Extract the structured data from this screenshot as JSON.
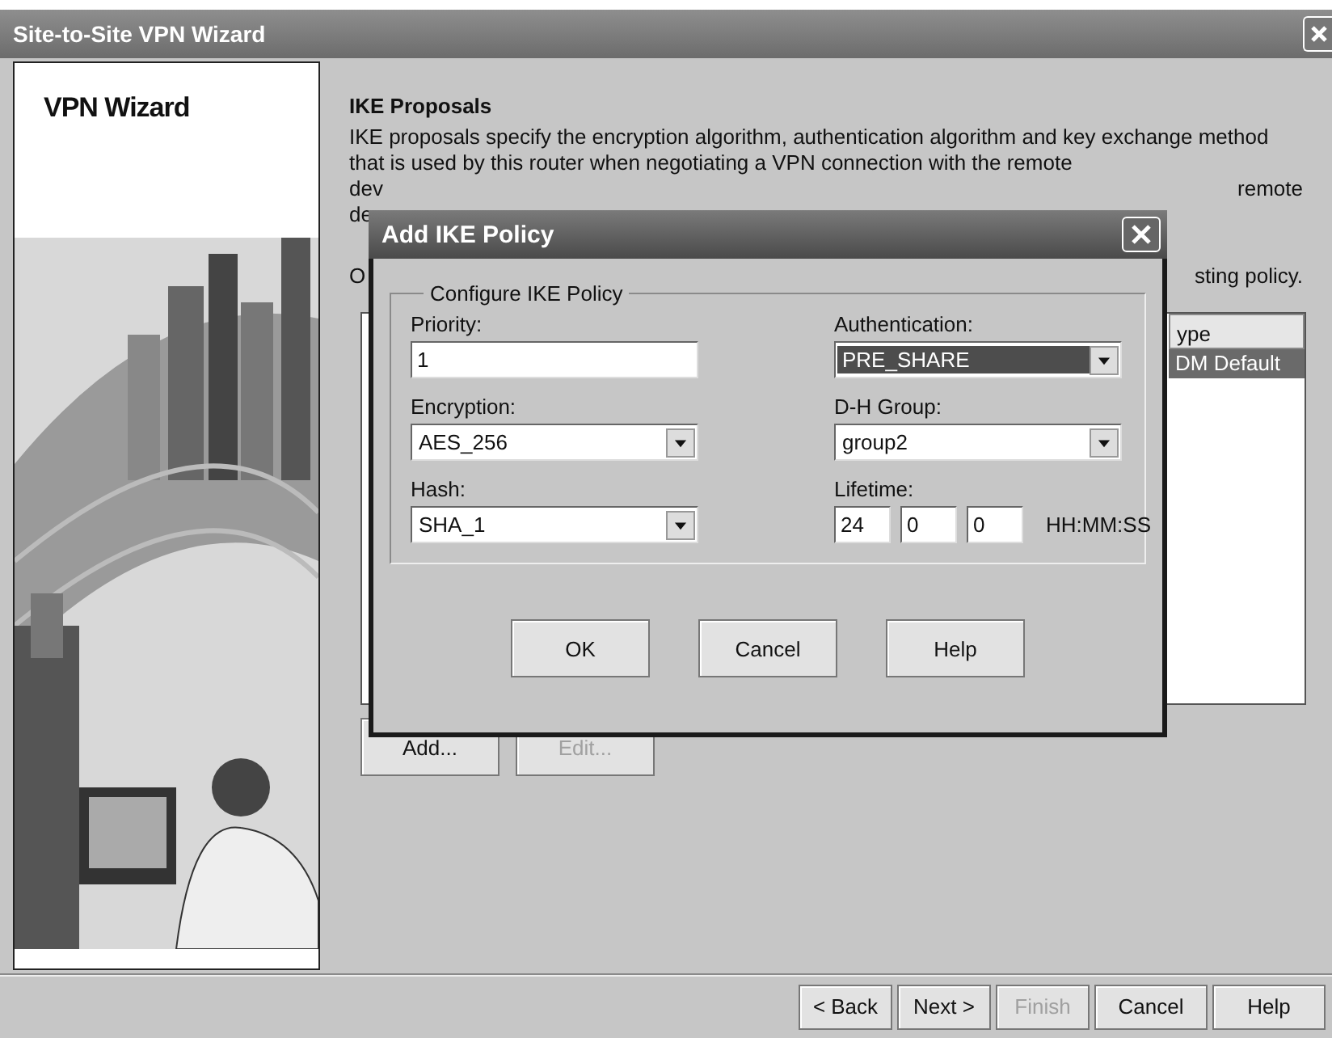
{
  "window": {
    "title": "Site-to-Site VPN Wizard"
  },
  "sidebar": {
    "title": "VPN Wizard"
  },
  "section": {
    "heading": "IKE Proposals",
    "description": "IKE proposals specify the encryption algorithm, authentication algorithm and key exchange method that is used by this router when negotiating a VPN connection with the remote",
    "partly_covered": [
      {
        "left": "dev",
        "right": "remote"
      },
      {
        "left": "de"
      },
      {
        "left": "O",
        "right": "sting policy."
      }
    ]
  },
  "table": {
    "columns": [
      "ype"
    ],
    "rows": [
      {
        "cells": [
          "DM Default"
        ],
        "selected": true
      }
    ]
  },
  "list_buttons": [
    {
      "label": "Add...",
      "disabled": false
    },
    {
      "label": "Edit...",
      "disabled": true
    }
  ],
  "dialog": {
    "title": "Add IKE Policy",
    "group": "Configure IKE Policy",
    "fields": [
      {
        "kind": "text",
        "label": "Priority:",
        "value": "1"
      },
      {
        "kind": "select",
        "label": "Authentication:",
        "value": "PRE_SHARE",
        "focused": true
      },
      {
        "kind": "select",
        "label": "Encryption:",
        "value": "AES_256",
        "focused": false
      },
      {
        "kind": "select",
        "label": "D-H Group:",
        "value": "group2",
        "focused": false
      },
      {
        "kind": "select",
        "label": "Hash:",
        "value": "SHA_1",
        "focused": false
      },
      {
        "kind": "lifetime",
        "label": "Lifetime:",
        "values": [
          "24",
          "0",
          "0"
        ],
        "unit": "HH:MM:SS"
      }
    ],
    "buttons": [
      "OK",
      "Cancel",
      "Help"
    ]
  },
  "footer_buttons": [
    {
      "label": "< Back",
      "disabled": false
    },
    {
      "label": "Next >",
      "disabled": false
    },
    {
      "label": "Finish",
      "disabled": true
    },
    {
      "label": "Cancel",
      "disabled": false
    },
    {
      "label": "Help",
      "disabled": false
    }
  ]
}
